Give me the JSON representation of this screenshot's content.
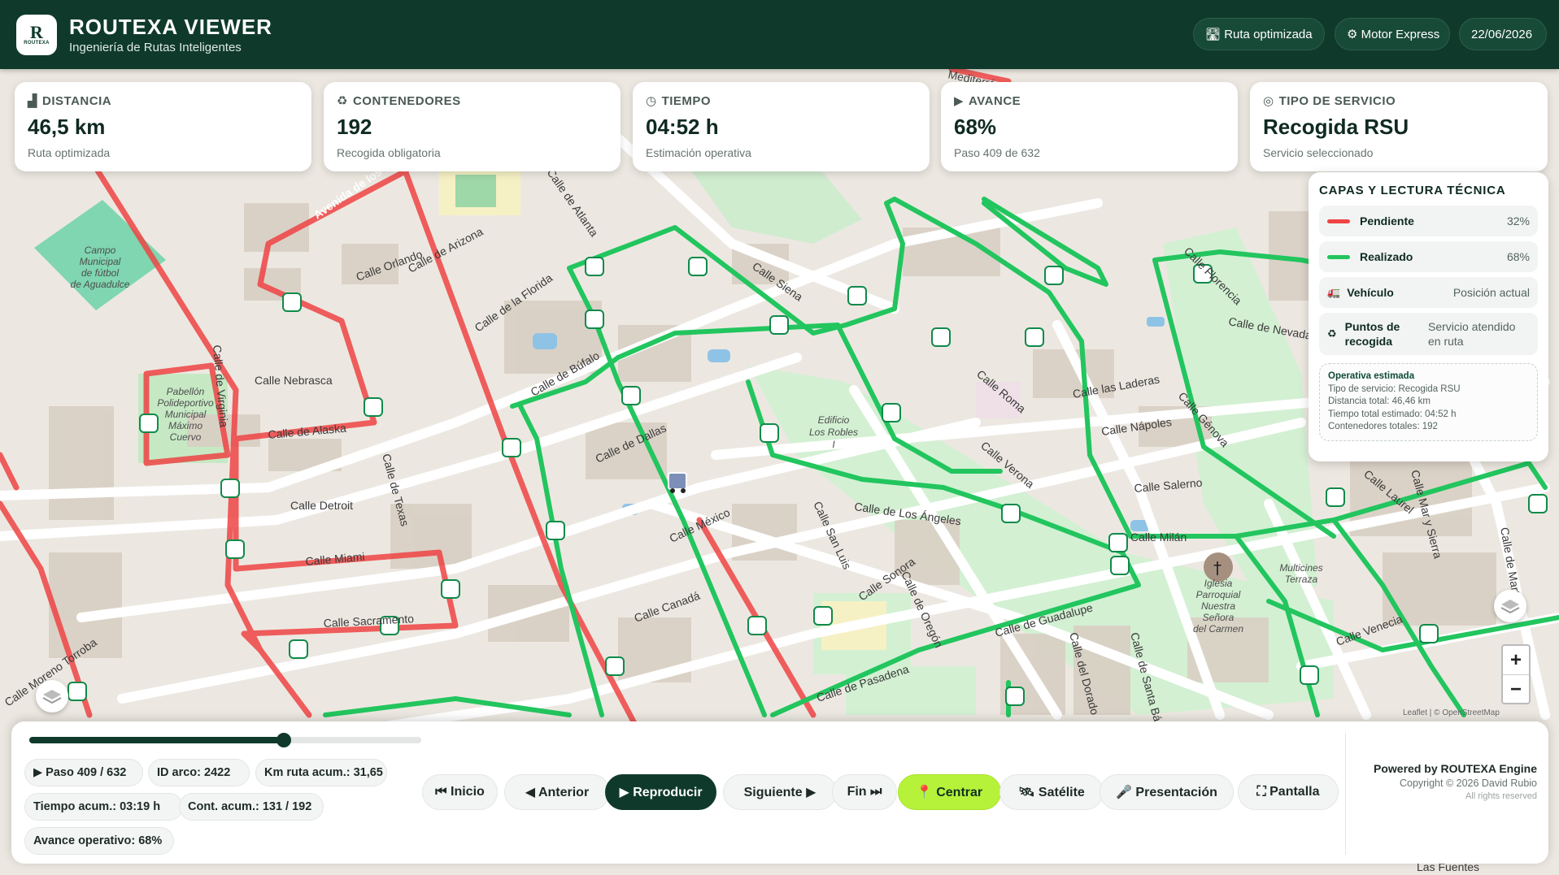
{
  "header": {
    "logo_letter": "R",
    "logo_small": "ROUTEXA",
    "title": "ROUTEXA VIEWER",
    "subtitle": "Ingeniería de Rutas Inteligentes",
    "pills": [
      "🛣 Ruta optimizada",
      "⚙ Motor Express",
      "22/06/2026"
    ]
  },
  "stats": [
    {
      "icon": "▟",
      "label": "DISTANCIA",
      "value": "46,5 km",
      "sub": "Ruta optimizada"
    },
    {
      "icon": "♻",
      "label": "CONTENEDORES",
      "value": "192",
      "sub": "Recogida obligatoria"
    },
    {
      "icon": "◷",
      "label": "TIEMPO",
      "value": "04:52 h",
      "sub": "Estimación operativa"
    },
    {
      "icon": "▶",
      "label": "AVANCE",
      "value": "68%",
      "sub": "Paso 409 de 632"
    },
    {
      "icon": "◎",
      "label": "TIPO DE SERVICIO",
      "value": "Recogida RSU",
      "sub": "Servicio seleccionado"
    }
  ],
  "layers_panel": {
    "title": "CAPAS Y LECTURA TÉCNICA",
    "rows": [
      {
        "label": "Pendiente",
        "right": "32%",
        "color": "#ef4444"
      },
      {
        "label": "Realizado",
        "right": "68%",
        "color": "#22c55e"
      },
      {
        "label": "Vehículo",
        "right": "Posición actual",
        "icon": "🚛"
      },
      {
        "label": "Puntos de recogida",
        "right": "Servicio atendido en ruta",
        "icon": "♻"
      }
    ],
    "info": {
      "title": "Operativa estimada",
      "lines": [
        "Tipo de servicio: Recogida RSU",
        "Distancia total: 46,46 km",
        "Tiempo total estimado: 04:52 h",
        "Contenedores totales: 192"
      ]
    }
  },
  "map": {
    "streets": [
      "Avenida de los Estados",
      "Calle Orlando",
      "Calle de Arizona",
      "Calle de Atlanta",
      "Calle de la Florida",
      "Calle Nebrasca",
      "Calle de Alaska",
      "Calle de Búfalo",
      "Calle de Dallas",
      "Calle Detroit",
      "Calle de Texas",
      "Calle Miami",
      "Calle Sacramento",
      "Calle México",
      "Calle Canadá",
      "Calle Siena",
      "Calle de Los Ángeles",
      "Calle San Luis",
      "Calle Sonora",
      "Calle de Oregón",
      "Calle de Pasadena",
      "Calle de Guadalupe",
      "Calle del Dorado",
      "Calle de Santa Bárbara",
      "Calle Verona",
      "Calle las Laderas",
      "Calle Nápoles",
      "Calle Génova",
      "Calle Salerno",
      "Calle Florencia",
      "Calle Laurel",
      "Calle Mar y Sierra",
      "Calle Venecia",
      "Calle de Virginia",
      "Calle de Martín",
      "Calle Moreno Torroba",
      "Calle Roma",
      "Calle Milán",
      "Calle de Nevada",
      "Las Fuentes"
    ],
    "pois": [
      "Campo Municipal de fútbol de Aguadulce",
      "Pabellón Polideportivo Municipal Máximo Cuervo",
      "Edificio Los Robles I",
      "Iglesia Parroquial Nuestra Señora del Carmen",
      "Multicines Terraza"
    ],
    "fragment_label": "Mediterráneo",
    "attribution": "Leaflet | © OpenStreetMap"
  },
  "controls": {
    "progress": 0.65,
    "chips": [
      "▶ Paso 409 / 632",
      "ID arco: 2422",
      "Km ruta acum.: 31,65",
      "Tiempo acum.: 03:19 h",
      "Cont. acum.: 131 / 192",
      "Avance operativo: 68%"
    ],
    "buttons": [
      "⏮ Inicio",
      "◀ Anterior",
      "▶ Reproducir",
      "Siguiente ▶",
      "Fin ⏭",
      "📍 Centrar",
      "🛰 Satélite",
      "🎤 Presentación",
      "⛶ Pantalla"
    ],
    "powered": "Powered by ROUTEXA Engine",
    "copyright": "Copyright © 2026 David Rubio",
    "rights": "All rights reserved"
  },
  "colors": {
    "brand": "#0f3a2b",
    "done": "#22c55e",
    "pending": "#ef4444",
    "accent": "#b7f23a"
  }
}
